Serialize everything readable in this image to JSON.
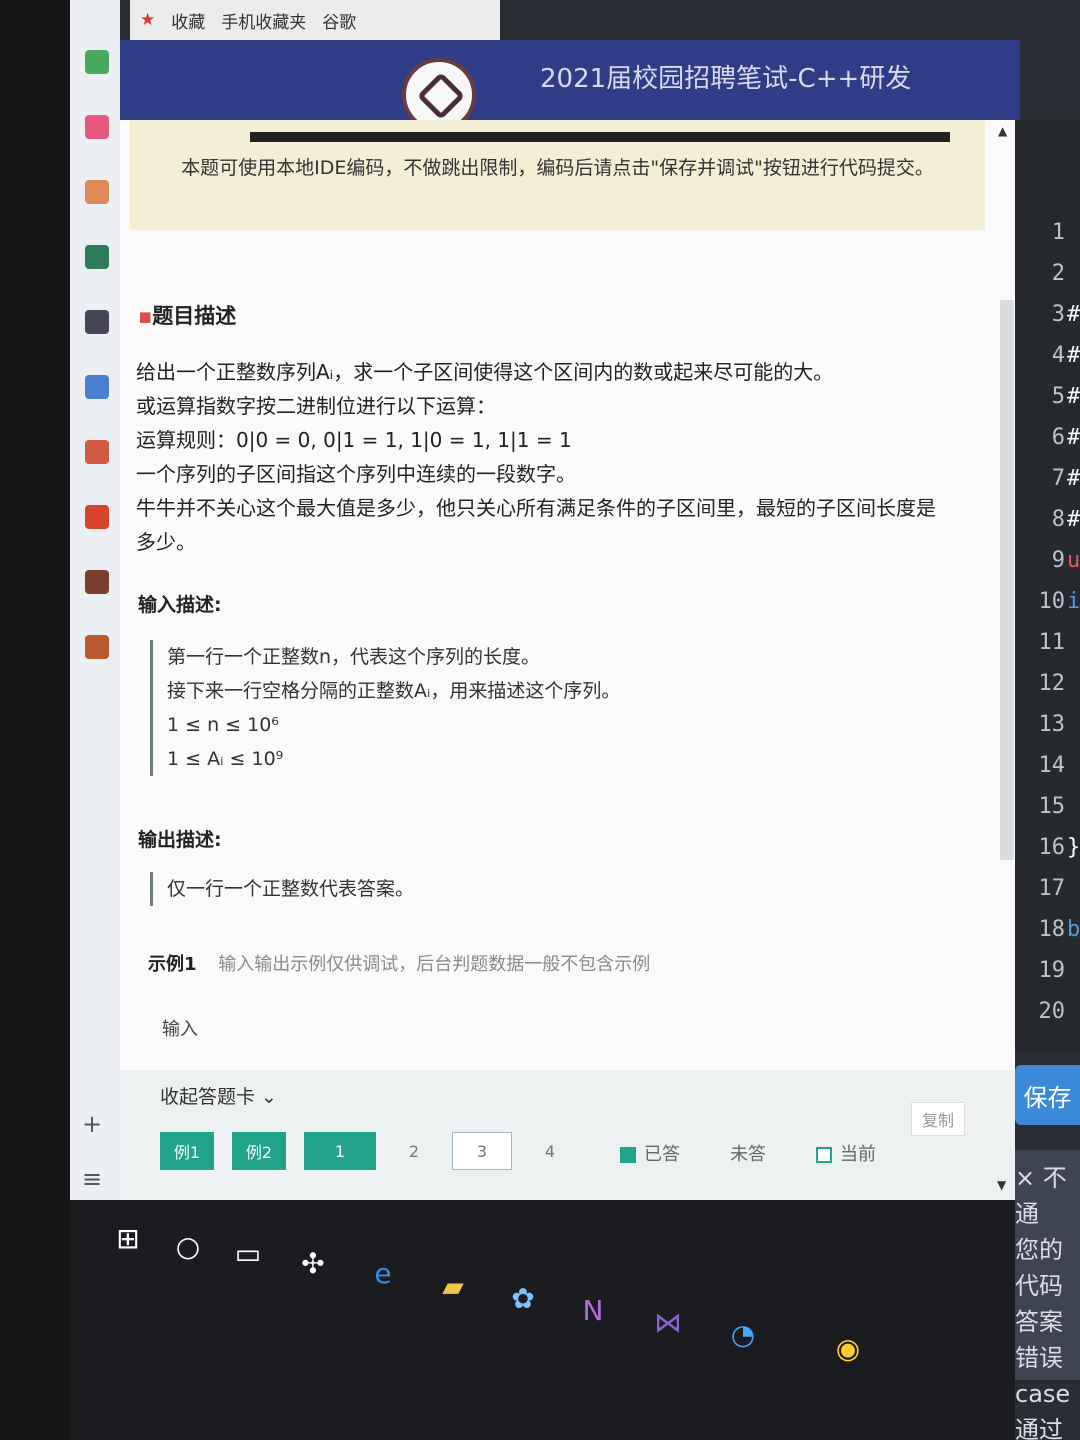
{
  "browser": {
    "bookmarks": [
      "收藏",
      "手机收藏夹",
      "谷歌"
    ],
    "title": "2021届校园招聘笔试-C++研发"
  },
  "notice": "本题可使用本地IDE编码，不做跳出限制，编码后请点击\"保存并调试\"按钮进行代码提交。",
  "problem": {
    "title": "题目描述",
    "desc": [
      "给出一个正整数序列Aᵢ，求一个子区间使得这个区间内的数或起来尽可能的大。",
      "或运算指数字按二进制位进行以下运算：",
      "运算规则：0|0 = 0, 0|1 = 1, 1|0 = 1, 1|1 = 1",
      "一个序列的子区间指这个序列中连续的一段数字。",
      "牛牛并不关心这个最大值是多少，他只关心所有满足条件的子区间里，最短的子区间长度是多少。"
    ],
    "input_title": "输入描述:",
    "input": [
      "第一行一个正整数n，代表这个序列的长度。",
      "接下来一行空格分隔的正整数Aᵢ，用来描述这个序列。",
      "1 ≤ n ≤ 10⁶",
      "1 ≤ Aᵢ ≤ 10⁹"
    ],
    "output_title": "输出描述:",
    "output": "仅一行一个正整数代表答案。",
    "example_label": "示例1",
    "example_note": "输入输出示例仅供调试，后台判题数据一般不包含示例",
    "input_label": "输入",
    "copy": "复制"
  },
  "answer_card": {
    "collapse": "收起答题卡 ⌄",
    "chips": [
      "例1",
      "例2",
      "1",
      "2",
      "3",
      "4"
    ],
    "legend": [
      "已答",
      "未答",
      "当前"
    ]
  },
  "editor": {
    "lines": [
      "1",
      "2",
      "3",
      "4",
      "5",
      "6",
      "7",
      "8",
      "9",
      "10",
      "11",
      "12",
      "13",
      "14",
      "15",
      "16",
      "17",
      "18",
      "19",
      "20"
    ],
    "code": [
      "",
      "",
      "#",
      "#",
      "#",
      "#",
      "#",
      "#",
      "u",
      "i",
      "",
      "",
      "",
      "",
      "",
      "}",
      "",
      "boo",
      "",
      ""
    ],
    "save": "保存",
    "result": [
      "× 不通",
      "您的代码",
      "答案错误",
      "case通过"
    ]
  },
  "colors": {
    "accent": "#21a38c",
    "header": "#2f3d86",
    "notice": "#f4eed4"
  }
}
